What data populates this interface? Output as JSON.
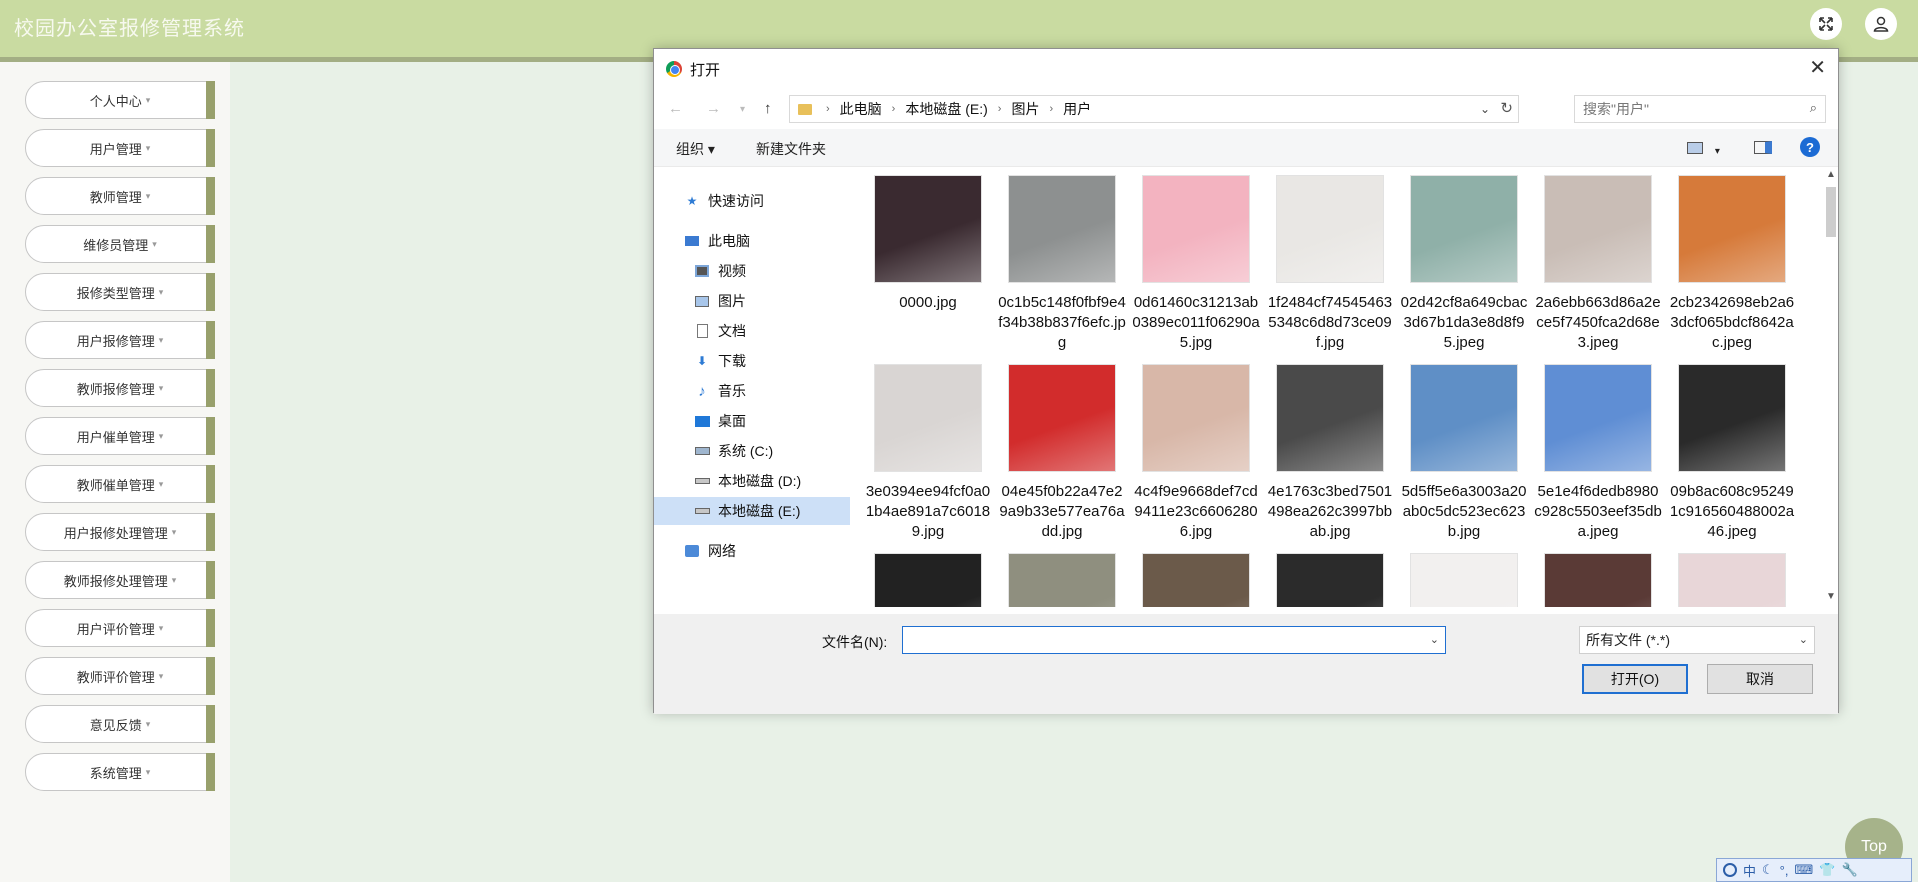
{
  "header": {
    "title": "校园办公室报修管理系统",
    "fullscreen_icon": "expand-icon",
    "user_icon": "user-icon"
  },
  "sidebar": {
    "items": [
      {
        "label": "个人中心"
      },
      {
        "label": "用户管理"
      },
      {
        "label": "教师管理"
      },
      {
        "label": "维修员管理"
      },
      {
        "label": "报修类型管理"
      },
      {
        "label": "用户报修管理"
      },
      {
        "label": "教师报修管理"
      },
      {
        "label": "用户催单管理"
      },
      {
        "label": "教师催单管理"
      },
      {
        "label": "用户报修处理管理"
      },
      {
        "label": "教师报修处理管理"
      },
      {
        "label": "用户评价管理"
      },
      {
        "label": "教师评价管理"
      },
      {
        "label": "意见反馈"
      },
      {
        "label": "系统管理"
      }
    ],
    "caret": "▾"
  },
  "top_button": {
    "label": "Top"
  },
  "dialog": {
    "title": "打开",
    "close": "✕",
    "address": {
      "crumbs": [
        "此电脑",
        "本地磁盘 (E:)",
        "图片",
        "用户"
      ]
    },
    "search": {
      "placeholder": "搜索\"用户\""
    },
    "toolbar": {
      "organize": "组织 ▾",
      "new_folder": "新建文件夹",
      "help": "?"
    },
    "nav": [
      {
        "label": "快速访问",
        "icon": "star-icon"
      },
      {
        "label": "此电脑",
        "icon": "computer-icon"
      },
      {
        "label": "视频",
        "icon": "video-icon"
      },
      {
        "label": "图片",
        "icon": "picture-icon"
      },
      {
        "label": "文档",
        "icon": "document-icon"
      },
      {
        "label": "下载",
        "icon": "download-icon"
      },
      {
        "label": "音乐",
        "icon": "music-icon"
      },
      {
        "label": "桌面",
        "icon": "desktop-icon"
      },
      {
        "label": "系统 (C:)",
        "icon": "drive-icon"
      },
      {
        "label": "本地磁盘 (D:)",
        "icon": "drive-icon"
      },
      {
        "label": "本地磁盘 (E:)",
        "icon": "drive-icon",
        "selected": true
      },
      {
        "label": "网络",
        "icon": "network-icon"
      }
    ],
    "files": [
      {
        "name": "0000.jpg",
        "color": "#3a2a30"
      },
      {
        "name": "0c1b5c148f0fbf9e4f34b38b837f6efc.jpg",
        "color": "#8d9090"
      },
      {
        "name": "0d61460c31213ab0389ec011f06290a5.jpg",
        "color": "#f3b3c0"
      },
      {
        "name": "1f2484cf745454635348c6d8d73ce09f.jpg",
        "color": "#e9e7e4"
      },
      {
        "name": "02d42cf8a649cbac3d67b1da3e8d8f95.jpeg",
        "color": "#8fb0a8"
      },
      {
        "name": "2a6ebb663d86a2ece5f7450fca2d68e3.jpeg",
        "color": "#c9bdb6"
      },
      {
        "name": "2cb2342698eb2a63dcf065bdcf8642ac.jpeg",
        "color": "#d67a3a"
      },
      {
        "name": "3e0394ee94fcf0a01b4ae891a7c60189.jpg",
        "color": "#d9d5d3"
      },
      {
        "name": "04e45f0b22a47e29a9b33e577ea76add.jpg",
        "color": "#d22c2c"
      },
      {
        "name": "4c4f9e9668def7cd9411e23c66062806.jpg",
        "color": "#d8b7a8"
      },
      {
        "name": "4e1763c3bed7501498ea262c3997bbab.jpg",
        "color": "#4a4a4a"
      },
      {
        "name": "5d5ff5e6a3003a20ab0c5dc523ec623b.jpg",
        "color": "#5f8fc6"
      },
      {
        "name": "5e1e4f6dedb8980c928c5503eef35dba.jpeg",
        "color": "#5f8ed4"
      },
      {
        "name": "09b8ac608c952491c916560488002a46.jpeg",
        "color": "#2a2a2a"
      },
      {
        "name": "",
        "color": "#222222"
      },
      {
        "name": "",
        "color": "#8f8f7f"
      },
      {
        "name": "",
        "color": "#6b5a4a"
      },
      {
        "name": "",
        "color": "#2b2b2b"
      },
      {
        "name": "",
        "color": "#f2f0ef"
      },
      {
        "name": "",
        "color": "#5a3a36"
      },
      {
        "name": "",
        "color": "#e8d6d8"
      }
    ],
    "filename_label": "文件名(N):",
    "filename_value": "",
    "filetype": "所有文件 (*.*)",
    "open_button": "打开(O)",
    "cancel_button": "取消"
  },
  "ime": {
    "items": [
      "中",
      "☾",
      "°,",
      "⌨",
      "👕",
      "🔧"
    ]
  },
  "colors": {
    "header": "#c9dba1",
    "sidebar_accent": "#98a06c",
    "selection": "#cde0f7",
    "primary": "#1f6fd1"
  }
}
